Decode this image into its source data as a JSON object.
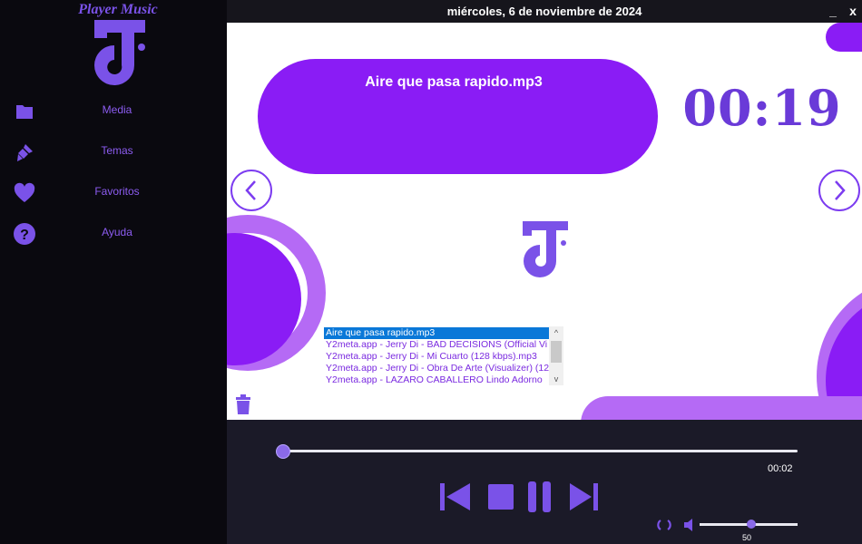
{
  "app": {
    "title": "Player Music"
  },
  "sidebar": {
    "items": [
      {
        "label": "Media",
        "icon": "folder-icon"
      },
      {
        "label": "Temas",
        "icon": "brush-icon"
      },
      {
        "label": "Favoritos",
        "icon": "heart-icon"
      },
      {
        "label": "Ayuda",
        "icon": "help-icon"
      }
    ]
  },
  "topbar": {
    "date": "miércoles, 6 de noviembre de 2024",
    "minimize": "_",
    "close": "x"
  },
  "player": {
    "current_song": "Aire que pasa rapido.mp3",
    "clock": "00:19",
    "elapsed": "00:02",
    "progress": 0.0,
    "volume": 50,
    "volume_label": "50"
  },
  "playlist": {
    "items": [
      "Aire que pasa rapido.mp3",
      "Y2meta.app - Jerry Di - BAD DECISIONS (Official Vi",
      "Y2meta.app - Jerry Di - Mi Cuarto (128 kbps).mp3",
      "Y2meta.app - Jerry Di - Obra De Arte (Visualizer) (128",
      "Y2meta.app - LAZARO CABALLERO Lindo Adorno"
    ],
    "selected_index": 0
  },
  "colors": {
    "accent": "#8a1cf5",
    "accent_light": "#b56af5",
    "sidebar_bg": "#0a090f",
    "controls": "#7a52e8"
  }
}
